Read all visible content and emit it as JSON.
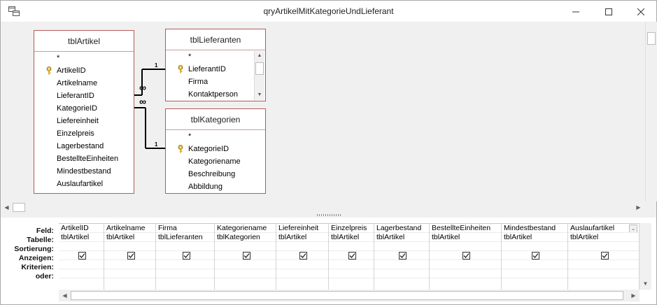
{
  "window": {
    "title": "qryArtikelMitKategorieUndLieferant",
    "minimize_glyph": "—",
    "maximize_glyph": "☐",
    "close_glyph": "✕"
  },
  "tables": {
    "artikel": {
      "name": "tblArtikel",
      "fields": [
        "*",
        "ArtikelID",
        "Artikelname",
        "LieferantID",
        "KategorieID",
        "Liefereinheit",
        "Einzelpreis",
        "Lagerbestand",
        "BestellteEinheiten",
        "Mindestbestand",
        "Auslaufartikel"
      ]
    },
    "lieferanten": {
      "name": "tblLieferanten",
      "fields": [
        "*",
        "LieferantID",
        "Firma",
        "Kontaktperson"
      ]
    },
    "kategorien": {
      "name": "tblKategorien",
      "fields": [
        "*",
        "KategorieID",
        "Kategoriename",
        "Beschreibung",
        "Abbildung"
      ]
    }
  },
  "relations": {
    "one_label": "1",
    "many_label": "∞"
  },
  "grid": {
    "row_labels": [
      "Feld:",
      "Tabelle:",
      "Sortierung:",
      "Anzeigen:",
      "Kriterien:",
      "oder:"
    ],
    "columns": [
      {
        "field": "ArtikelID",
        "table": "tblArtikel",
        "show": true
      },
      {
        "field": "Artikelname",
        "table": "tblArtikel",
        "show": true
      },
      {
        "field": "Firma",
        "table": "tblLieferanten",
        "show": true
      },
      {
        "field": "Kategoriename",
        "table": "tblKategorien",
        "show": true
      },
      {
        "field": "Liefereinheit",
        "table": "tblArtikel",
        "show": true
      },
      {
        "field": "Einzelpreis",
        "table": "tblArtikel",
        "show": true
      },
      {
        "field": "Lagerbestand",
        "table": "tblArtikel",
        "show": true
      },
      {
        "field": "BestellteEinheiten",
        "table": "tblArtikel",
        "show": true
      },
      {
        "field": "Mindestbestand",
        "table": "tblArtikel",
        "show": true
      },
      {
        "field": "Auslaufartikel",
        "table": "tblArtikel",
        "show": true
      }
    ],
    "check_glyph": "✓",
    "dropdown_glyph": "⌄"
  },
  "colors": {
    "table_border": "#b25b5b",
    "join_line": "#000000"
  }
}
